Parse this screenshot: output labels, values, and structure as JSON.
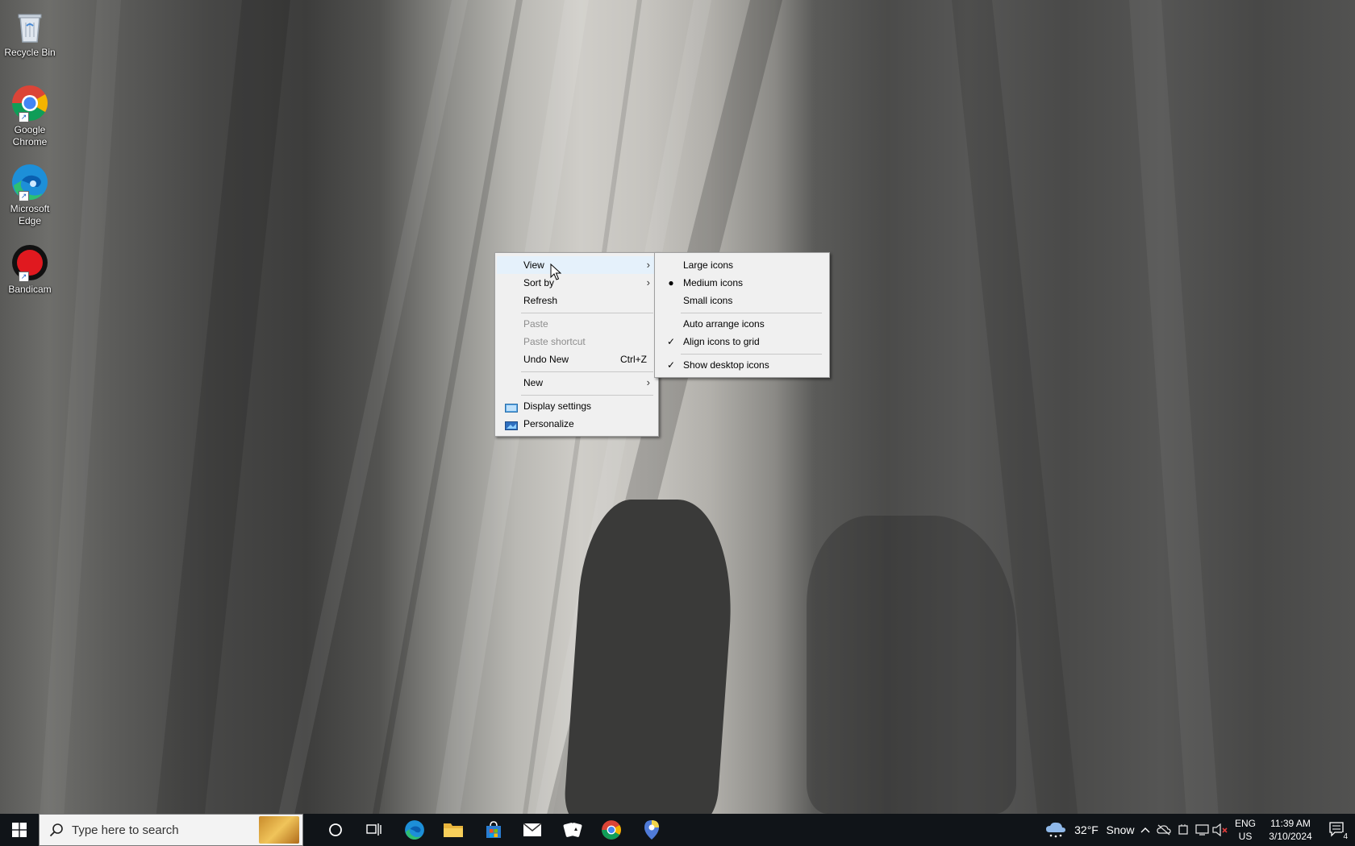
{
  "desktop": {
    "icons": [
      {
        "label": "Recycle Bin",
        "icon": "recycle-bin-icon"
      },
      {
        "label": "Google\nChrome",
        "icon": "chrome-icon"
      },
      {
        "label": "Microsoft\nEdge",
        "icon": "edge-icon"
      },
      {
        "label": "Bandicam",
        "icon": "bandicam-icon"
      }
    ]
  },
  "context_menu": {
    "view": "View",
    "sort_by": "Sort by",
    "refresh": "Refresh",
    "paste": "Paste",
    "paste_shortcut": "Paste shortcut",
    "undo_new": "Undo New",
    "undo_new_shortcut": "Ctrl+Z",
    "new": "New",
    "display_settings": "Display settings",
    "personalize": "Personalize"
  },
  "view_submenu": {
    "large_icons": "Large icons",
    "medium_icons": "Medium icons",
    "small_icons": "Small icons",
    "auto_arrange": "Auto arrange icons",
    "align_to_grid": "Align icons to grid",
    "show_desktop_icons": "Show desktop icons",
    "selected_size": "Medium icons",
    "align_to_grid_checked": true,
    "show_desktop_icons_checked": true,
    "auto_arrange_checked": false
  },
  "taskbar": {
    "search_placeholder": "Type here to search",
    "weather_temp": "32°F",
    "weather_condition": "Snow",
    "language": "ENG",
    "region": "US",
    "time": "11:39 AM",
    "date": "3/10/2024",
    "notification_count": "4",
    "pinned": [
      "task-view-icon",
      "edge-icon",
      "file-explorer-icon",
      "store-icon",
      "mail-icon",
      "solitaire-icon",
      "chrome-icon",
      "maps-icon"
    ]
  }
}
